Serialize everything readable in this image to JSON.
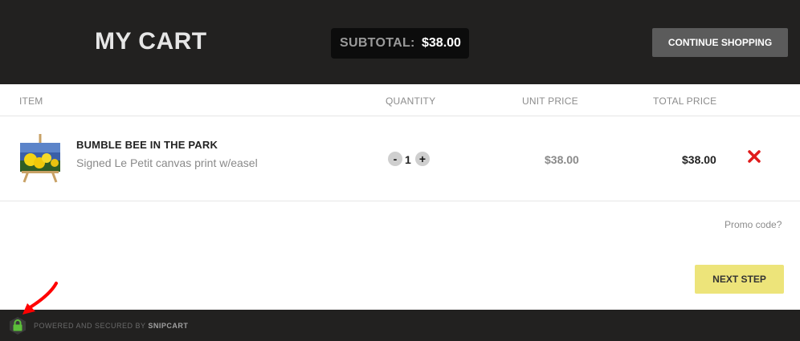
{
  "header": {
    "title": "MY CART",
    "subtotal_label": "SUBTOTAL:",
    "subtotal_value": "$38.00",
    "continue_label": "CONTINUE SHOPPING"
  },
  "columns": {
    "item": "ITEM",
    "quantity": "QUANTITY",
    "unit_price": "UNIT PRICE",
    "total_price": "TOTAL PRICE"
  },
  "cart_items": [
    {
      "name": "BUMBLE BEE IN THE PARK",
      "description": "Signed Le Petit canvas print w/easel",
      "quantity": "1",
      "unit_price": "$38.00",
      "total_price": "$38.00",
      "decrement_label": "-",
      "increment_label": "+"
    }
  ],
  "promo_label": "Promo code?",
  "next_step_label": "NEXT STEP",
  "footer": {
    "powered_text": "POWERED AND SECURED BY",
    "brand": "SNIPCART"
  },
  "colors": {
    "header_bg": "#222120",
    "accent_button": "#ede47a",
    "remove_icon": "#e01b1b",
    "lock_icon": "#5cbf3a",
    "annotation_arrow": "#ff0000"
  },
  "icons": [
    "close-icon",
    "lock-icon",
    "arrow-annotation"
  ]
}
